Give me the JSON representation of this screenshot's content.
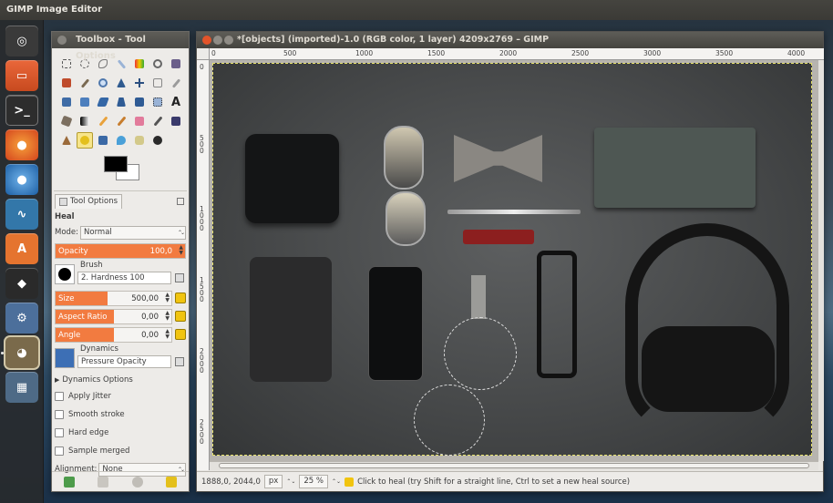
{
  "app": {
    "title": "GIMP Image Editor"
  },
  "launcher": {
    "items": [
      "dash-icon",
      "files-icon",
      "terminal-icon",
      "firefox-icon",
      "thunderbird-icon",
      "system-monitor-icon",
      "software-center-icon",
      "inkscape-icon",
      "settings-icon",
      "gimp-icon",
      "workspace-icon"
    ]
  },
  "toolbox": {
    "title": "Toolbox - Tool Options",
    "tab_label": "Tool Options",
    "tool_name": "Heal",
    "mode_label": "Mode:",
    "mode_value": "Normal",
    "opacity": {
      "label": "Opacity",
      "value": "100,0",
      "fraction": 1.0
    },
    "brush_label": "Brush",
    "brush_value": "2. Hardness 100",
    "size": {
      "label": "Size",
      "value": "500,00",
      "fraction": 0.45
    },
    "aspect": {
      "label": "Aspect Ratio",
      "value": "0,00",
      "fraction": 0.5
    },
    "angle": {
      "label": "Angle",
      "value": "0,00",
      "fraction": 0.5
    },
    "dynamics_label": "Dynamics",
    "dynamics_value": "Pressure Opacity",
    "dynamics_options": "Dynamics Options",
    "checks": [
      "Apply Jitter",
      "Smooth stroke",
      "Hard edge",
      "Sample merged"
    ],
    "alignment_label": "Alignment:",
    "alignment_value": "None"
  },
  "image_window": {
    "title": "*[objects] (imported)-1.0 (RGB color, 1 layer) 4209x2769 – GIMP",
    "ruler_h": [
      "0",
      "500",
      "1000",
      "1500",
      "2000",
      "2500",
      "3000",
      "3500",
      "4000"
    ],
    "ruler_v": [
      "0",
      "500",
      "1000",
      "1500",
      "2000",
      "2500"
    ]
  },
  "status": {
    "coords": "1888,0, 2044,0",
    "unit": "px",
    "zoom": "25 %",
    "message": "Click to heal (try Shift for a straight line, Ctrl to set a new heal source)"
  },
  "colors": {
    "accent": "#f27b40",
    "fg": "#000000",
    "bg": "#ffffff"
  }
}
